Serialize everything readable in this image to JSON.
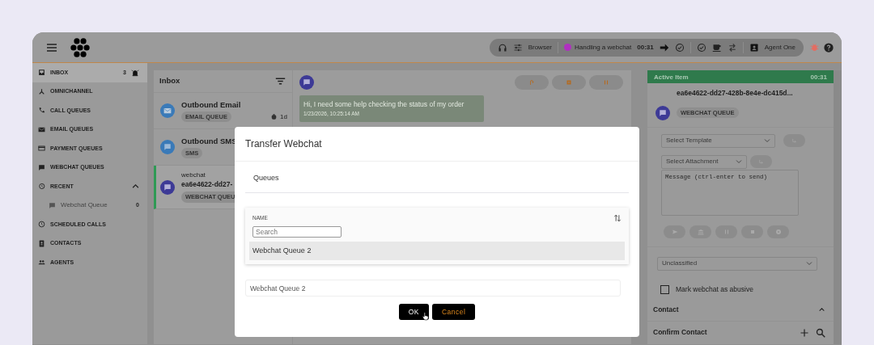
{
  "header": {
    "status": {
      "device": "Browser",
      "state": "Handling a webchat",
      "color": "#b030c0",
      "timer": "00:31",
      "agent": "Agent One"
    }
  },
  "sidebar": {
    "items": [
      {
        "label": "INBOX",
        "count": "3",
        "selected": true,
        "alarm": true
      },
      {
        "label": "OMNICHANNEL",
        "selected": false
      },
      {
        "label": "CALL QUEUES",
        "selected": false
      },
      {
        "label": "EMAIL QUEUES",
        "selected": false
      },
      {
        "label": "PAYMENT QUEUES",
        "selected": false
      },
      {
        "label": "WEBCHAT QUEUES",
        "selected": false
      },
      {
        "label": "RECENT",
        "selected": false,
        "expanded": true,
        "children": [
          {
            "label": "Webchat Queue",
            "count": "0"
          }
        ]
      },
      {
        "label": "SCHEDULED CALLS",
        "selected": false
      },
      {
        "label": "CONTACTS",
        "selected": false
      },
      {
        "label": "AGENTS",
        "selected": false
      }
    ]
  },
  "inbox": {
    "title": "Inbox",
    "items": [
      {
        "kind": "email",
        "title": "Outbound Email",
        "tag": "EMAIL QUEUE",
        "age": "1d",
        "selected": false
      },
      {
        "kind": "sms",
        "title": "Outbound SMS",
        "tag": "SMS",
        "selected": false
      },
      {
        "kind": "webchat",
        "subtitle": "webchat",
        "title": "ea6e4622-dd27-",
        "tag": "WEBCHAT QUEU",
        "selected": true
      }
    ]
  },
  "chat": {
    "messages": [
      {
        "text": "Hi, I need some help checking the status of my order",
        "time": "1/23/2026, 10:25:14 AM"
      }
    ]
  },
  "active_item": {
    "title": "Active Item",
    "timer": "00:31",
    "id": "ea6e4622-dd27-428b-8e4e-dc415d...",
    "tag": "WEBCHAT QUEUE",
    "template": {
      "placeholder": "Select Template"
    },
    "attachment": {
      "placeholder": "Select Attachment"
    },
    "message": {
      "placeholder": "Message (ctrl-enter to send)"
    },
    "classification": "Unclassified",
    "abusive": {
      "label": "Mark webchat as abusive",
      "checked": false
    },
    "sections": [
      {
        "title": "Contact",
        "expanded": true
      },
      {
        "title": "Confirm Contact"
      }
    ]
  },
  "dialog": {
    "title": "Transfer Webchat",
    "tab": "Queues",
    "column": "NAME",
    "search": {
      "placeholder": "Search"
    },
    "rows": [
      {
        "name": "Webchat Queue 2",
        "selected": true
      }
    ],
    "selection": "Webchat Queue 2",
    "buttons": [
      "OK",
      "Cancel"
    ]
  }
}
